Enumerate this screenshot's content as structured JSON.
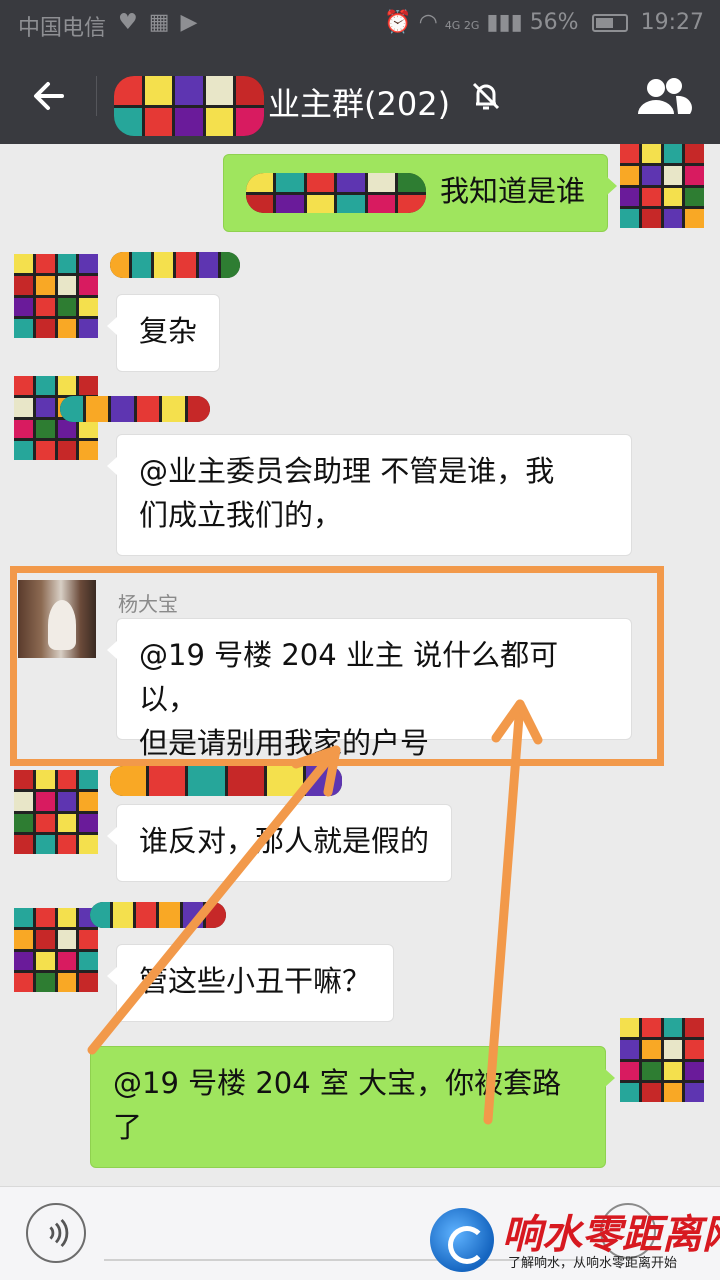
{
  "status_bar": {
    "carrier": "中国电信",
    "signal_text": "4G 2G",
    "battery_percent": "56%",
    "time": "19:27"
  },
  "header": {
    "title": "业主群(202)",
    "icons": [
      "back-arrow",
      "mute-bell",
      "group-members"
    ]
  },
  "messages": [
    {
      "side": "right",
      "text": "我知道是谁",
      "name": ""
    },
    {
      "side": "left",
      "text": "复杂",
      "name": ""
    },
    {
      "side": "left",
      "text": "@业主委员会助理  不管是谁，我",
      "text2": "们成立我们的，",
      "name": ""
    },
    {
      "side": "left",
      "text": "@19 号楼 204 业主  说什么都可以，",
      "text2": "但是请别用我家的户号",
      "name": "杨大宝"
    },
    {
      "side": "left",
      "text": "谁反对，那人就是假的",
      "name": ""
    },
    {
      "side": "left",
      "text": "管这些小丑干嘛？",
      "name": ""
    },
    {
      "side": "right",
      "text": "@19 号楼 204 室  大宝，你被套路",
      "text2": "了",
      "name": ""
    }
  ],
  "annotations": {
    "highlight_color": "#f2994a"
  },
  "watermark": {
    "title": "响水零距离网",
    "subtitle": "了解响水，从响水零距离开始"
  },
  "colors": {
    "header_bg": "#393a3f",
    "chat_bg": "#ebebeb",
    "bubble_self": "#9fe55e",
    "bubble_other": "#ffffff"
  }
}
